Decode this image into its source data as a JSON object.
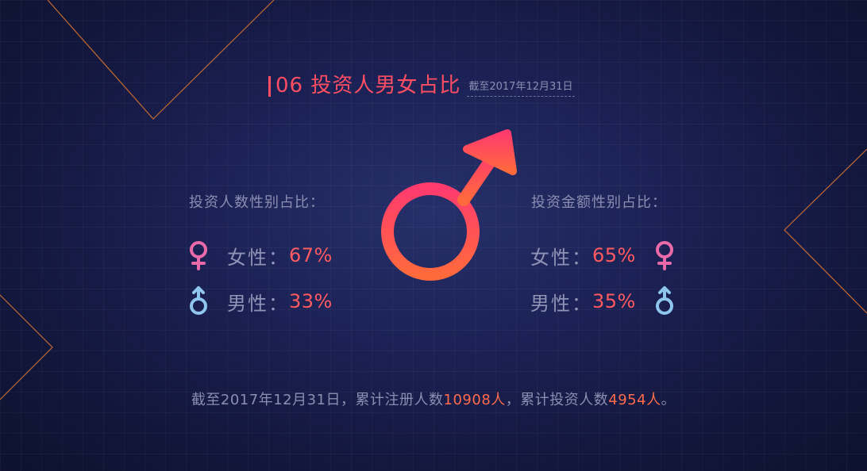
{
  "title": {
    "text": "06 投资人男女占比",
    "date": "截至2017年12月31日"
  },
  "left_panel": {
    "heading": "投资人数性别占比：",
    "female": {
      "label": "女性：",
      "value": "67%"
    },
    "male": {
      "label": "男性：",
      "value": "33%"
    }
  },
  "right_panel": {
    "heading": "投资金额性别占比：",
    "female": {
      "label": "女性：",
      "value": "65%"
    },
    "male": {
      "label": "男性：",
      "value": "35%"
    }
  },
  "footer": {
    "prefix": "截至2017年12月31日，累计注册人数",
    "registered": "10908人",
    "middle": "，累计投资人数",
    "investors": "4954人",
    "suffix": "。"
  },
  "icons": {
    "female": "female-symbol-icon",
    "male": "male-symbol-icon",
    "center": "gender-symbol-icon"
  },
  "colors": {
    "accent": "#ff4e63",
    "female_icon": "#e96aa8",
    "male_icon": "#8fc6ee",
    "highlight": "#ff6b4a",
    "deco_line": "#e0782f"
  }
}
